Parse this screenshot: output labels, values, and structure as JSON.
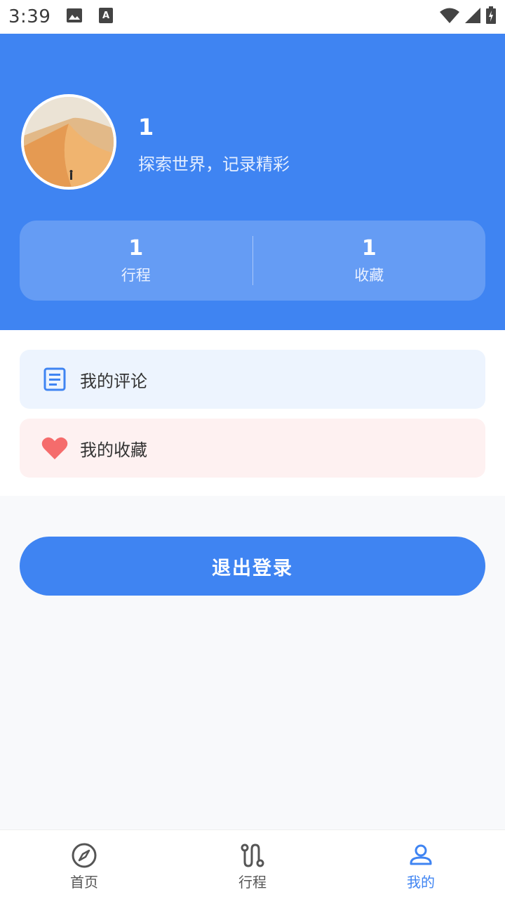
{
  "status_bar": {
    "time": "3:39",
    "icons": [
      "image-icon",
      "text-a-icon",
      "wifi-icon",
      "signal-icon",
      "battery-charging-icon"
    ]
  },
  "profile": {
    "name": "1",
    "motto": "探索世界，记录精彩",
    "avatar": "desert-dune-photo"
  },
  "stats": [
    {
      "value": "1",
      "label": "行程"
    },
    {
      "value": "1",
      "label": "收藏"
    }
  ],
  "menu": {
    "comments_label": "我的评论",
    "favorites_label": "我的收藏"
  },
  "logout_label": "退出登录",
  "tabs": [
    {
      "label": "首页",
      "icon": "compass-icon",
      "active": false
    },
    {
      "label": "行程",
      "icon": "route-icon",
      "active": false
    },
    {
      "label": "我的",
      "icon": "user-icon",
      "active": true
    }
  ],
  "colors": {
    "primary": "#3f84f2",
    "favorite_heart": "#f56c6c",
    "comments_bg": "#edf4fe",
    "favorites_bg": "#fef1f1"
  }
}
